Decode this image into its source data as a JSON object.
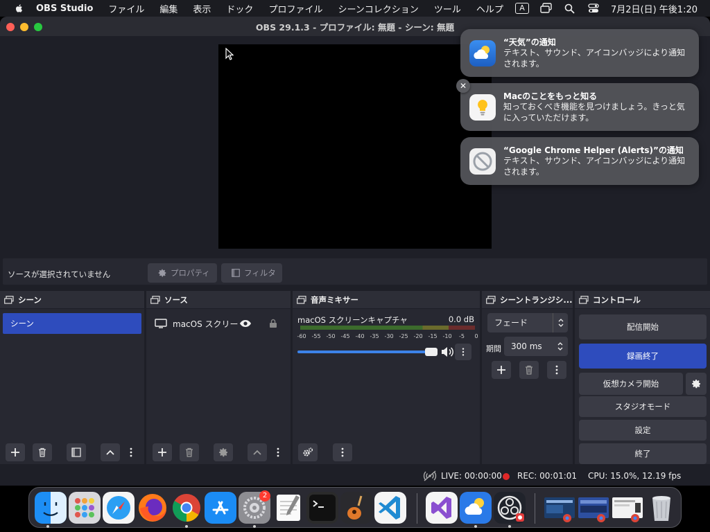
{
  "menubar": {
    "app": "OBS Studio",
    "items": [
      "ファイル",
      "編集",
      "表示",
      "ドック",
      "プロファイル",
      "シーンコレクション",
      "ツール",
      "ヘルプ"
    ],
    "input_indicator": "A",
    "datetime": "7月2日(日) 午後1:20"
  },
  "window": {
    "title": "OBS 29.1.3 - プロファイル: 無題 - シーン: 無題"
  },
  "source_bar": {
    "no_source": "ソースが選択されていません",
    "properties": "プロパティ",
    "filters": "フィルタ"
  },
  "scenes": {
    "title": "シーン",
    "items": [
      "シーン"
    ]
  },
  "sources": {
    "title": "ソース",
    "items": [
      "macOS スクリー"
    ]
  },
  "mixer": {
    "title": "音声ミキサー",
    "channel": "macOS スクリーンキャプチャ",
    "level": "0.0 dB",
    "ticks": [
      "-60",
      "-55",
      "-50",
      "-45",
      "-40",
      "-35",
      "-30",
      "-25",
      "-20",
      "-15",
      "-10",
      "-5",
      "0"
    ],
    "volume": 1.0
  },
  "transitions": {
    "title": "シーントランジシ...",
    "type": "フェード",
    "duration_label": "期間",
    "duration": "300 ms"
  },
  "controls": {
    "title": "コントロール",
    "start_stream": "配信開始",
    "stop_recording": "録画終了",
    "virtual_camera": "仮想カメラ開始",
    "studio_mode": "スタジオモード",
    "settings": "設定",
    "exit": "終了"
  },
  "status": {
    "live": "LIVE: 00:00:00",
    "rec": "REC: 00:01:01",
    "cpu": "CPU: 15.0%, 12.19 fps"
  },
  "notifications": [
    {
      "title": "“天気”の通知",
      "body": "テキスト、サウンド、アイコンバッジにより通知されます。",
      "icon": "weather-icon"
    },
    {
      "title": "Macのことをもっと知る",
      "body": "知っておくべき機能を見つけましょう。きっと気に入っていただけます。",
      "icon": "tips-icon"
    },
    {
      "title": "“Google Chrome Helper (Alerts)”の通知",
      "body": "テキスト、サウンド、アイコンバッジにより通知されます。",
      "icon": "chrome-helper-icon"
    }
  ],
  "dock": {
    "settings_badge": "2"
  },
  "colors": {
    "accent": "#2e4cbd",
    "rec_dot": "#e02828",
    "panel": "#272831",
    "background": "#1e1f27"
  }
}
